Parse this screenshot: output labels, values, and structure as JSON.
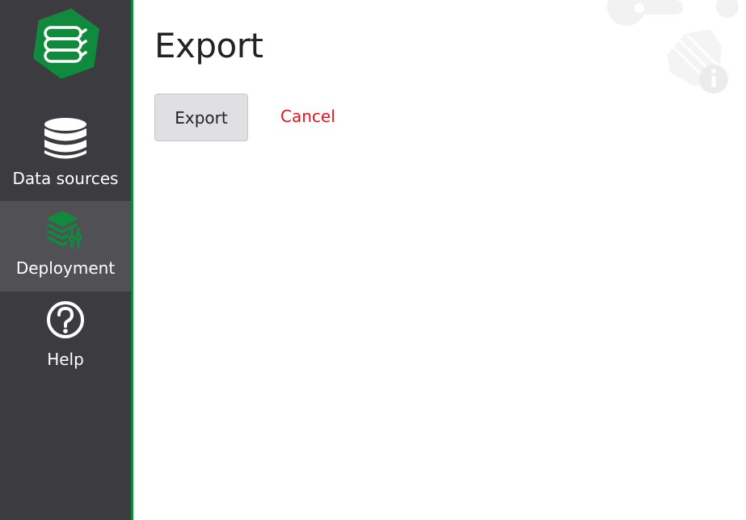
{
  "sidebar": {
    "logo_icon": "stacked-layers-logo-icon",
    "items": [
      {
        "label": "Data sources",
        "icon": "database-icon",
        "active": false
      },
      {
        "label": "Deployment",
        "icon": "deployment-layers-icon",
        "active": true
      },
      {
        "label": "Help",
        "icon": "question-circle-icon",
        "active": false
      }
    ]
  },
  "main": {
    "title": "Export",
    "export_button_label": "Export",
    "cancel_link_label": "Cancel"
  },
  "colors": {
    "sidebar_bg": "#3c3b40",
    "sidebar_active_bg": "#505055",
    "accent_green": "#108a3d",
    "cancel_red": "#e8111b",
    "button_bg": "#e0e0e2"
  }
}
